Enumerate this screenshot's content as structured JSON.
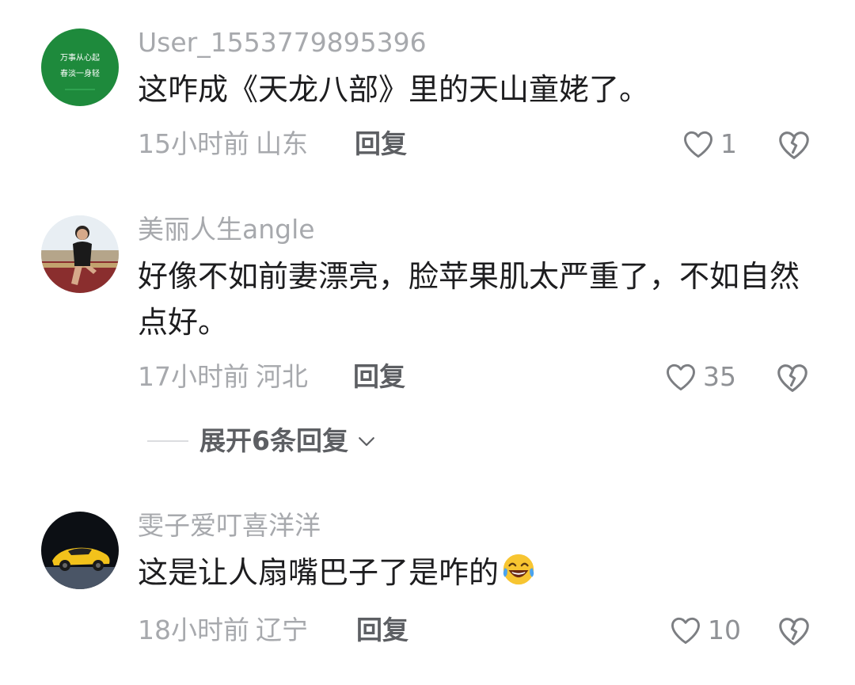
{
  "comments": [
    {
      "username": "User_1553779895396",
      "text": "这咋成《天龙八部》里的天山童姥了。",
      "time": "15小时前",
      "location": "山东",
      "reply_label": "回复",
      "likes": "1",
      "avatar": {
        "type": "green-text",
        "line1": "万事从心起",
        "line2": "春淡一身轻",
        "color": "#1e8a3c"
      }
    },
    {
      "username": "美丽人生angle",
      "text": "好像不如前妻漂亮，脸苹果肌太严重了，不如自然点好。",
      "time": "17小时前",
      "location": "河北",
      "reply_label": "回复",
      "likes": "35",
      "avatar": {
        "type": "photo-person"
      }
    },
    {
      "username": "雯子爱叮喜洋洋",
      "text": "这是让人扇嘴巴子了是咋的",
      "emoji": "laughing-tears-emoji",
      "time": "18小时前",
      "location": "辽宁",
      "reply_label": "回复",
      "likes": "10",
      "avatar": {
        "type": "photo-car"
      }
    }
  ],
  "expand_replies": {
    "label": "展开6条回复"
  },
  "icons": {
    "like": "heart-outline-icon",
    "dislike": "broken-heart-icon",
    "expand": "chevron-down-icon"
  }
}
